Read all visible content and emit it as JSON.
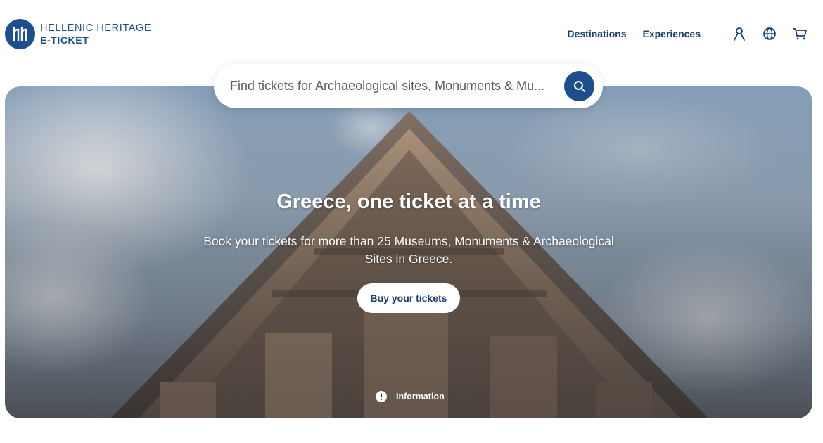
{
  "brand": {
    "line1": "HELLENIC HERITAGE",
    "line2": "E-TICKET",
    "color": "#1d4f8f"
  },
  "nav": {
    "links": [
      "Destinations",
      "Experiences"
    ],
    "icons": [
      "user-icon",
      "globe-icon",
      "cart-icon"
    ]
  },
  "search": {
    "placeholder": "Find tickets for Archaeological sites, Monuments & Mu...",
    "button_icon": "search-icon"
  },
  "hero": {
    "title": "Greece, one ticket at a time",
    "subtitle": "Book your tickets for more than 25 Museums, Monuments & Archaeological Sites in Greece.",
    "cta_label": "Buy your tickets",
    "info_label": "Information",
    "info_icon": "exclamation-circle-icon"
  }
}
